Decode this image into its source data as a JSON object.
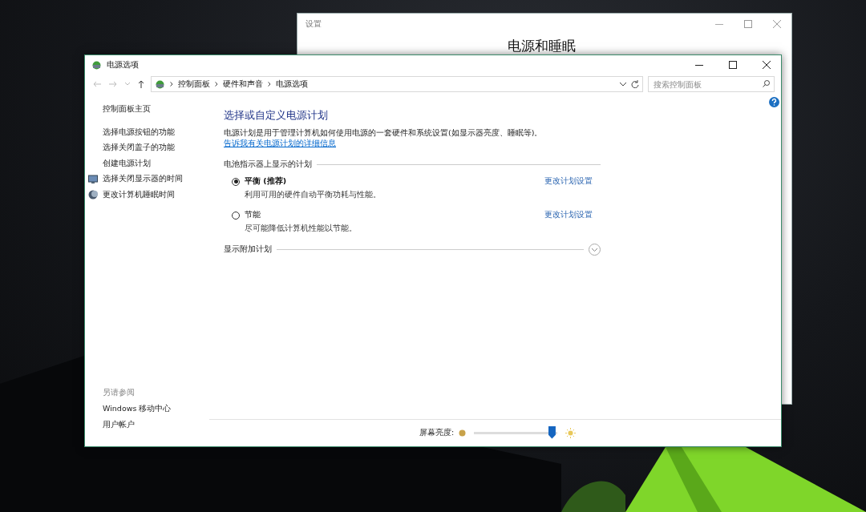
{
  "back_window": {
    "title": "设置",
    "heading": "电源和睡眠"
  },
  "window": {
    "title": "电源选项"
  },
  "address_bar": {
    "breadcrumbs": [
      "控制面板",
      "硬件和声音",
      "电源选项"
    ]
  },
  "search": {
    "placeholder": "搜索控制面板"
  },
  "sidebar": {
    "items": [
      {
        "label": "控制面板主页",
        "kind": "home"
      },
      {
        "label": "选择电源按钮的功能",
        "kind": "link"
      },
      {
        "label": "选择关闭盖子的功能",
        "kind": "link"
      },
      {
        "label": "创建电源计划",
        "kind": "link"
      },
      {
        "label": "选择关闭显示器的时间",
        "kind": "monitor"
      },
      {
        "label": "更改计算机睡眠时间",
        "kind": "moon"
      }
    ],
    "see_also": {
      "title": "另请参阅",
      "items": [
        "Windows 移动中心",
        "用户帐户"
      ]
    }
  },
  "main": {
    "title": "选择或自定义电源计划",
    "intro": "电源计划是用于管理计算机如何使用电源的一套硬件和系统设置(如显示器亮度、睡眠等)。",
    "intro_link": "告诉我有关电源计划的详细信息",
    "group_title": "电池指示器上显示的计划",
    "plans": [
      {
        "name": "平衡 (推荐)",
        "description": "利用可用的硬件自动平衡功耗与性能。",
        "link": "更改计划设置",
        "selected": true
      },
      {
        "name": "节能",
        "description": "尽可能降低计算机性能以节能。",
        "link": "更改计划设置",
        "selected": false
      }
    ],
    "more_plans": "显示附加计划"
  },
  "brightness": {
    "label": "屏幕亮度:",
    "level": 0.93
  }
}
